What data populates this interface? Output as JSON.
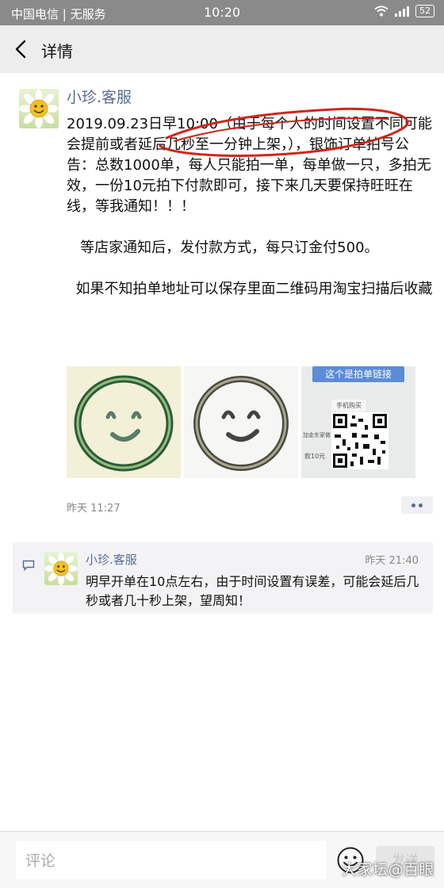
{
  "status_bar": {
    "carrier": "中国电信 | 无服务",
    "time": "10:20",
    "battery": "52"
  },
  "nav": {
    "title": "详情"
  },
  "post": {
    "author": "小珍.客服",
    "paragraphs": [
      "2019.09.23日早10:00（由于每个人的时间设置不同可能会提前或者延后几秒至一分钟上架，），银饰订单拍号公告：总数1000单，每人只能拍一单，每单做一只，多拍无效，一份10元拍下付款即可，接下来几天要保持旺旺在线，等我通知！！！",
      "   等店家通知后，发付款方式，每只订金付500。",
      "  如果不知拍单地址可以保存里面二维码用淘宝扫描后收藏"
    ],
    "image3": {
      "caption": "这个是拍单链接",
      "button_text": "手机购买",
      "side_text1": "加金东家做",
      "side_text2": "款10元"
    },
    "time": "昨天 11:27"
  },
  "comment": {
    "name": "小珍.客服",
    "time": "昨天 21:40",
    "text": "明早开单在10点左右，由于时间设置有误差，可能会延后几秒或者几十秒上架，望周知！"
  },
  "bottom_bar": {
    "input_placeholder": "评论",
    "send_label": "发送"
  },
  "watermark": "大家坛@百眼",
  "colors": {
    "link_blue": "#576b95",
    "status_bar": "#8a8a8a",
    "annotation_red": "#d0261c"
  }
}
